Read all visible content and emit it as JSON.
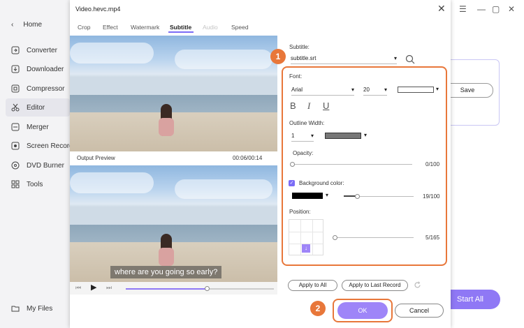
{
  "sidebar": {
    "home": "Home",
    "items": [
      "Converter",
      "Downloader",
      "Compressor",
      "Editor",
      "Merger",
      "Screen Recorder",
      "DVD Burner",
      "Tools"
    ],
    "my_files": "My Files"
  },
  "background_app": {
    "save": "Save",
    "start_all": "Start All"
  },
  "dialog": {
    "title": "Video.hevc.mp4",
    "tabs": [
      "Crop",
      "Effect",
      "Watermark",
      "Subtitle",
      "Audio",
      "Speed"
    ],
    "active_tab": "Subtitle",
    "output_preview": "Output Preview",
    "timecode": "00:06/00:14",
    "subtitle_overlay": "where are you going so early?",
    "playback_progress": 0.55
  },
  "panel": {
    "subtitle_label": "Subtitle:",
    "subtitle_file": "subtitle.srt",
    "font_label": "Font:",
    "font_name": "Arial",
    "font_size": "20",
    "bold": "B",
    "italic": "I",
    "underline": "U",
    "outline_width_label": "Outline Width:",
    "outline_width": "1",
    "opacity_label": "Opacity:",
    "opacity_value": "0/100",
    "background_color_label": "Background color:",
    "background_value": "19/100",
    "position_label": "Position:",
    "position_value": "5/165",
    "apply_all": "Apply to All",
    "apply_last": "Apply to Last Record",
    "ok": "OK",
    "cancel": "Cancel"
  },
  "callouts": {
    "one": "1",
    "two": "2"
  },
  "colors": {
    "accent": "#7b6cf6",
    "ok": "#9e85f8",
    "callout": "#e8773a",
    "font_color": "#ffffff",
    "outline_color": "#777777",
    "background_color": "#000000"
  }
}
